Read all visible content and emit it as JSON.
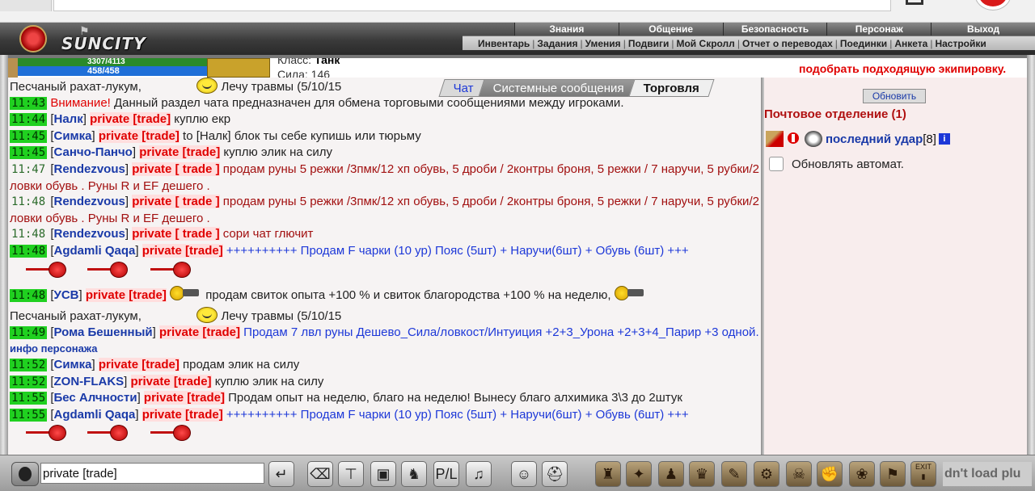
{
  "header": {
    "logo_text": "SUNCITY",
    "main_menu": [
      "Знания",
      "Общение",
      "Безопасность",
      "Персонаж",
      "Выход"
    ],
    "sub_menu": [
      "Инвентарь",
      "Задания",
      "Умения",
      "Подвиги",
      "Мой Скролл",
      "Отчет о переводах",
      "Поединки",
      "Анкета",
      "Настройки"
    ]
  },
  "character": {
    "hp": "3307/4113",
    "mana": "458/458",
    "class_label": "Класс:",
    "class_value": "Танк",
    "strength": "Сила: 146",
    "notice": "подобрать подходящую экипировку."
  },
  "tabs": {
    "chat": "Чат",
    "system": "Системные сообщения",
    "trade": "Торговля"
  },
  "chat": {
    "top_line": {
      "text": "Песчаный рахат-лукум,",
      "after_smile": "Лечу травмы (5/10/15"
    },
    "messages": [
      {
        "time": "11:43",
        "warn": "Внимание!",
        "text": "Данный раздел чата предназначен для обмена торговыми сообщениями между игроками."
      },
      {
        "time": "11:44",
        "nick": "Налк",
        "ptag": "private [trade]",
        "text": "куплю екр"
      },
      {
        "time": "11:45",
        "nick": "Симка",
        "ptag": "private [trade]",
        "text": "to [Налк] блок ты себе купишь или тюрьму"
      },
      {
        "time": "11:45",
        "nick": "Санчо-Панчо",
        "ptag": "private [trade]",
        "text": "куплю элик на силу"
      },
      {
        "time": "11:47",
        "nick": "Rendezvous",
        "ptag": "private [ trade ]",
        "text": "продам руны 5 режки /3пмк/12 хп обувь, 5 дроби / 2контры броня, 5 режки / 7 наручи, 5 рубки/2 ловки обувь . Руны R и EF дешего ."
      },
      {
        "time": "11:48",
        "nick": "Rendezvous",
        "ptag": "private [ trade ]",
        "text": "продам руны 5 режки /3пмк/12 хп обувь, 5 дроби / 2контры броня, 5 режки / 7 наручи, 5 рубки/2 ловки обувь . Руны R и EF дешего ."
      },
      {
        "time": "11:48",
        "nick": "Rendezvous",
        "ptag": "private [ trade ]",
        "text": "сори чат глючит"
      },
      {
        "time": "11:48",
        "nick": "Agdamli Qaqa",
        "ptag": "private [trade]",
        "text": "++++++++++ Продам F чарки (10 ур) Пояс (5шт) + Наручи(6шт) + Обувь (6шт) +++"
      },
      {
        "time": "11:48",
        "nick": "УСВ",
        "ptag": "private [trade]",
        "text": "продам свиток опыта +100 % и свиток благородства +100 % на неделю,"
      },
      {
        "time": "11:49",
        "nick": "Рома Бешенный",
        "ptag": "private [trade]",
        "text": "Продам 7 лвл руны Дешево_Сила/ловкост/Интуиция +2+3_Урона +2+3+4_Парир +3 одной.",
        "extra": "инфо персонажа"
      },
      {
        "time": "11:52",
        "nick": "Симка",
        "ptag": "private [trade]",
        "text": "продам элик на силу"
      },
      {
        "time": "11:52",
        "nick": "ZON-FLAKS",
        "ptag": "private [trade]",
        "text": "куплю элик на силу"
      },
      {
        "time": "11:55",
        "nick": "Бес Алчности",
        "ptag": "private [trade]",
        "text": "Продам опыт на неделю, благо на неделю! Вынесу благо алхимика 3\\3 до 2штук"
      },
      {
        "time": "11:55",
        "nick": "Agdamli Qaqa",
        "ptag": "private [trade]",
        "text": "++++++++++ Продам F чарки (10 ур) Пояс (5шт) + Наручи(6шт) + Обувь (6шт) +++"
      }
    ]
  },
  "side": {
    "refresh": "Обновить",
    "post_title": "Почтовое отделение (1)",
    "user_name": "последний удар",
    "user_level": "[8]",
    "info": "i",
    "auto_refresh": "Обновлять автомат."
  },
  "toolbar": {
    "input_value": "private [trade]",
    "load_text": "dn't load plu",
    "icons": [
      "enter-icon",
      "eraser-icon",
      "filter-icon",
      "save-icon",
      "dance-icon",
      "pl-icon",
      "sound-icon",
      "smiley-icon",
      "helmet-icon",
      "bag-icon",
      "magic-icon",
      "potion-icon",
      "lion-icon",
      "scroll-icon",
      "gear-icon",
      "skull-icon",
      "fist-icon",
      "sheep-icon",
      "flag-icon",
      "exit-icon"
    ]
  },
  "colors": {
    "timestamp_bg": "#20d020",
    "private_trade": "#e00000",
    "nick": "#1a3aa8",
    "trade_text": "#1d38d8",
    "rune_text": "#a21010"
  }
}
